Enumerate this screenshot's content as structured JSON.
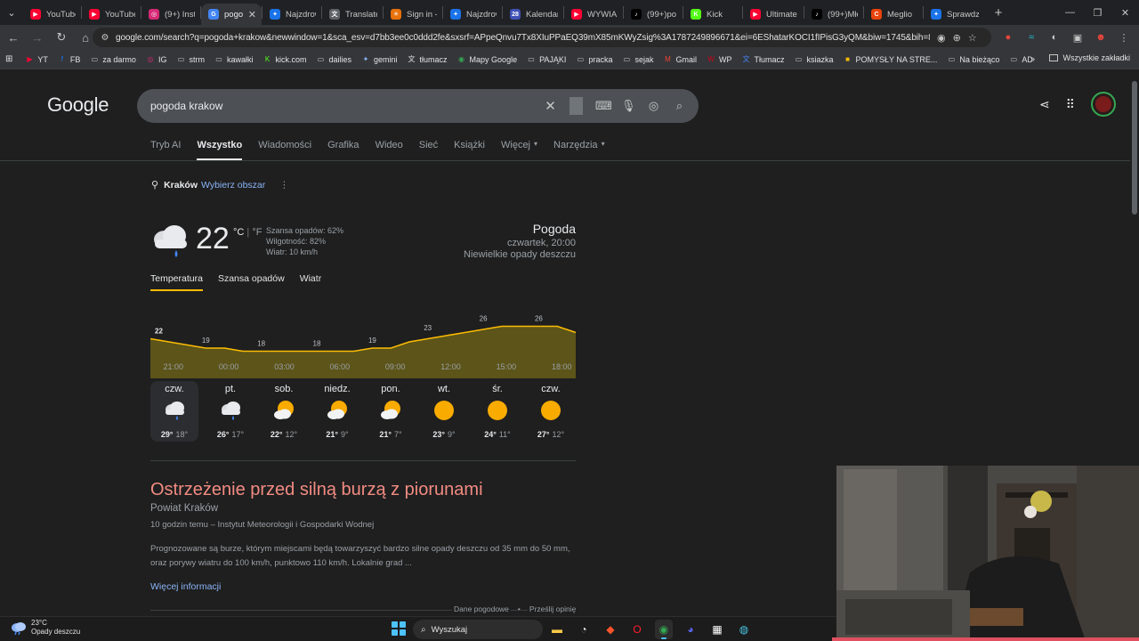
{
  "tabs": [
    {
      "label": "YouTube",
      "color": "#ff0033",
      "glyph": "▶"
    },
    {
      "label": "YouTube",
      "color": "#ff0033",
      "glyph": "▶"
    },
    {
      "label": "(9+) Insta",
      "color": "#d62976",
      "glyph": "◎"
    },
    {
      "label": "pogo",
      "color": "#4285f4",
      "glyph": "G",
      "active": true
    },
    {
      "label": "Najzdrow",
      "color": "#1a73e8",
      "glyph": "✦"
    },
    {
      "label": "Translate",
      "color": "#5f6368",
      "glyph": "文"
    },
    {
      "label": "Sign in -",
      "color": "#e8710a",
      "glyph": "✳"
    },
    {
      "label": "Najzdrow",
      "color": "#1a73e8",
      "glyph": "✦"
    },
    {
      "label": "Kalendarz",
      "color": "#3f51b5",
      "glyph": "28"
    },
    {
      "label": "WYWIAD",
      "color": "#ff0033",
      "glyph": "▶"
    },
    {
      "label": "(99+)po s",
      "color": "#000000",
      "glyph": "♪"
    },
    {
      "label": "Kick",
      "color": "#53fc18",
      "glyph": "K"
    },
    {
      "label": "Ultimate",
      "color": "#ff0033",
      "glyph": "▶"
    },
    {
      "label": "(99+)Mło",
      "color": "#000000",
      "glyph": "♪"
    },
    {
      "label": "Meglio",
      "color": "#e8430a",
      "glyph": "C"
    },
    {
      "label": "Sprawdza",
      "color": "#1a73e8",
      "glyph": "✦"
    }
  ],
  "omnibox": {
    "url": "google.com/search?q=pogoda+krakow&newwindow=1&sca_esv=d7bb3ee0c0ddd2fe&sxsrf=APpeQnvu7Tx8XIuPPaEQ39mX85mKWyZsig%3A1787249896671&ei=6EShatarKOCI1fIPisG3yQM&biw=1745&bih=828&ved=0..."
  },
  "bookmarks": [
    {
      "label": "YT",
      "glyph": "▶",
      "color": "#ff0033"
    },
    {
      "label": "FB",
      "glyph": "f",
      "color": "#1877f2"
    },
    {
      "label": "za darmo",
      "glyph": "▭",
      "color": "#c4c7c5"
    },
    {
      "label": "IG",
      "glyph": "◎",
      "color": "#d62976"
    },
    {
      "label": "strm",
      "glyph": "▭",
      "color": "#c4c7c5"
    },
    {
      "label": "kawałki",
      "glyph": "▭",
      "color": "#c4c7c5"
    },
    {
      "label": "kick.com",
      "glyph": "K",
      "color": "#53fc18"
    },
    {
      "label": "dailies",
      "glyph": "▭",
      "color": "#c4c7c5"
    },
    {
      "label": "gemini",
      "glyph": "✦",
      "color": "#8ab4f8"
    },
    {
      "label": "tłumacz",
      "glyph": "文",
      "color": "#e3e3e3"
    },
    {
      "label": "Mapy Google",
      "glyph": "◉",
      "color": "#34a853"
    },
    {
      "label": "PAJĄKI",
      "glyph": "▭",
      "color": "#c4c7c5"
    },
    {
      "label": "pracka",
      "glyph": "▭",
      "color": "#c4c7c5"
    },
    {
      "label": "sejak",
      "glyph": "▭",
      "color": "#c4c7c5"
    },
    {
      "label": "Gmail",
      "glyph": "M",
      "color": "#ea4335"
    },
    {
      "label": "WP",
      "glyph": "W",
      "color": "#d0021b"
    },
    {
      "label": "Tłumacz",
      "glyph": "文",
      "color": "#4285f4"
    },
    {
      "label": "ksiazka",
      "glyph": "▭",
      "color": "#c4c7c5"
    },
    {
      "label": "POMYSŁY NA STRE...",
      "glyph": "■",
      "color": "#fbbc04"
    },
    {
      "label": "Na bieżąco",
      "glyph": "▭",
      "color": "#c4c7c5"
    },
    {
      "label": "AD",
      "glyph": "▭",
      "color": "#c4c7c5"
    }
  ],
  "bookmarks_all": "Wszystkie zakładki",
  "google": {
    "logo": "Google",
    "query": "pogoda krakow",
    "tabs": [
      "Tryb AI",
      "Wszystko",
      "Wiadomości",
      "Grafika",
      "Wideo",
      "Sieć",
      "Książki",
      "Więcej",
      "Narzędzia"
    ],
    "active_tab": "Wszystko"
  },
  "location": {
    "city": "Kraków",
    "choose": "Wybierz obszar"
  },
  "weather": {
    "temp": "22",
    "unit_c": "°C",
    "unit_sep": "|",
    "unit_f": "°F",
    "precip": "Szansa opadów: 62%",
    "humidity": "Wilgotność: 82%",
    "wind": "Wiatr: 10 km/h",
    "title": "Pogoda",
    "datetime": "czwartek, 20:00",
    "condition": "Niewielkie opady deszczu",
    "tabs": [
      "Temperatura",
      "Szansa opadów",
      "Wiatr"
    ],
    "accent": "#fbbc04"
  },
  "chart_data": {
    "type": "area",
    "x": [
      "20:00",
      "21:00",
      "22:00",
      "23:00",
      "00:00",
      "01:00",
      "02:00",
      "03:00",
      "04:00",
      "05:00",
      "06:00",
      "07:00",
      "08:00",
      "09:00",
      "10:00",
      "11:00",
      "12:00",
      "13:00",
      "14:00",
      "15:00",
      "16:00",
      "17:00",
      "18:00",
      "19:00"
    ],
    "values": [
      22,
      21,
      20,
      19,
      19,
      18,
      18,
      18,
      18,
      18,
      18,
      18,
      19,
      19,
      21,
      22,
      23,
      24,
      25,
      26,
      26,
      26,
      26,
      24
    ],
    "labels": [
      {
        "x": "20:00",
        "value": 22
      },
      {
        "x": "23:00",
        "value": 19
      },
      {
        "x": "02:00",
        "value": 18
      },
      {
        "x": "05:00",
        "value": 18
      },
      {
        "x": "08:00",
        "value": 19
      },
      {
        "x": "11:00",
        "value": 23
      },
      {
        "x": "14:00",
        "value": 26
      },
      {
        "x": "17:00",
        "value": 26
      }
    ],
    "hour_ticks": [
      "21:00",
      "00:00",
      "03:00",
      "06:00",
      "09:00",
      "12:00",
      "15:00",
      "18:00"
    ],
    "ylim": [
      10,
      30
    ],
    "line_color": "#fbbc04",
    "fill_color": "#5c5419"
  },
  "days": [
    {
      "name": "czw.",
      "icon": "rain",
      "hi": "29°",
      "lo": "18°"
    },
    {
      "name": "pt.",
      "icon": "rain",
      "hi": "26°",
      "lo": "17°"
    },
    {
      "name": "sob.",
      "icon": "partly",
      "hi": "22°",
      "lo": "12°"
    },
    {
      "name": "niedz.",
      "icon": "partly",
      "hi": "21°",
      "lo": "9°"
    },
    {
      "name": "pon.",
      "icon": "partly",
      "hi": "21°",
      "lo": "7°"
    },
    {
      "name": "wt.",
      "icon": "sun",
      "hi": "23°",
      "lo": "9°"
    },
    {
      "name": "śr.",
      "icon": "sun",
      "hi": "24°",
      "lo": "11°"
    },
    {
      "name": "czw.",
      "icon": "sun",
      "hi": "27°",
      "lo": "12°"
    }
  ],
  "alert": {
    "title": "Ostrzeżenie przed silną burzą z piorunami",
    "subtitle": "Powiat Kraków",
    "source": "10 godzin temu – Instytut Meteorologii i Gospodarki Wodnej",
    "body": "Prognozowane są burze, którym miejscami będą towarzyszyć bardzo silne opady deszczu od 35 mm do 50 mm, oraz porywy wiatru do 100 km/h, punktowo 110 km/h. Lokalnie grad ...",
    "more": "Więcej informacji",
    "color": "#f28b82"
  },
  "footer": {
    "data": "Dane pogodowe",
    "dot": "•",
    "feedback": "Prześlij opinię"
  },
  "taskbar": {
    "weather_temp": "23°C",
    "weather_desc": "Opady deszczu",
    "search": "Wyszukaj"
  }
}
